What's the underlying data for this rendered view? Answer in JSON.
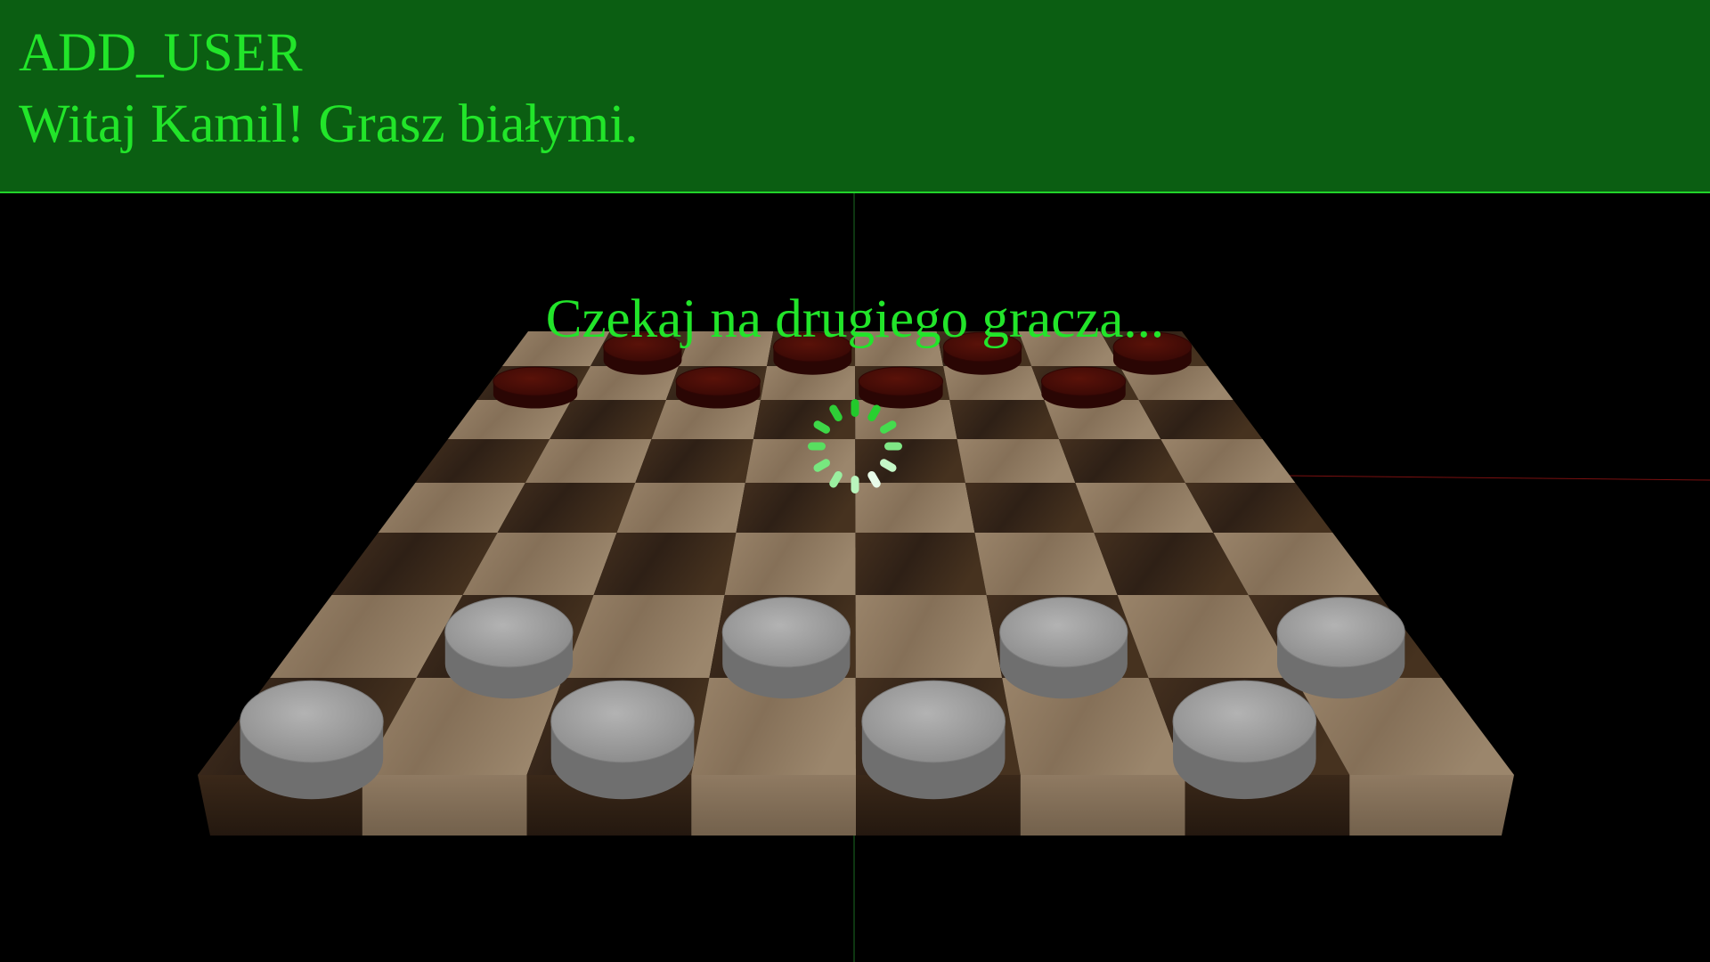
{
  "header": {
    "status": "ADD_USER",
    "greeting": "Witaj Kamil! Grasz białymi."
  },
  "overlay": {
    "wait_message": "Czekaj na drugiego gracza...",
    "spinner_icon": "loading-spinner-icon"
  },
  "colors": {
    "header_bg": "#0b5e12",
    "text_green": "#22e52a",
    "light_square": "#8f7a62",
    "dark_square": "#3d2a1f",
    "white_piece": "#9a9a9a",
    "red_piece": "#4a0d08"
  },
  "board": {
    "size": 8,
    "player_color": "white",
    "white_pieces": [
      {
        "row": 6,
        "col": 1
      },
      {
        "row": 6,
        "col": 3
      },
      {
        "row": 6,
        "col": 5
      },
      {
        "row": 6,
        "col": 7
      },
      {
        "row": 7,
        "col": 0
      },
      {
        "row": 7,
        "col": 2
      },
      {
        "row": 7,
        "col": 4
      },
      {
        "row": 7,
        "col": 6
      }
    ],
    "red_pieces": [
      {
        "row": 0,
        "col": 1
      },
      {
        "row": 0,
        "col": 3
      },
      {
        "row": 0,
        "col": 5
      },
      {
        "row": 0,
        "col": 7
      },
      {
        "row": 1,
        "col": 0
      },
      {
        "row": 1,
        "col": 2
      },
      {
        "row": 1,
        "col": 4
      },
      {
        "row": 1,
        "col": 6
      }
    ]
  }
}
